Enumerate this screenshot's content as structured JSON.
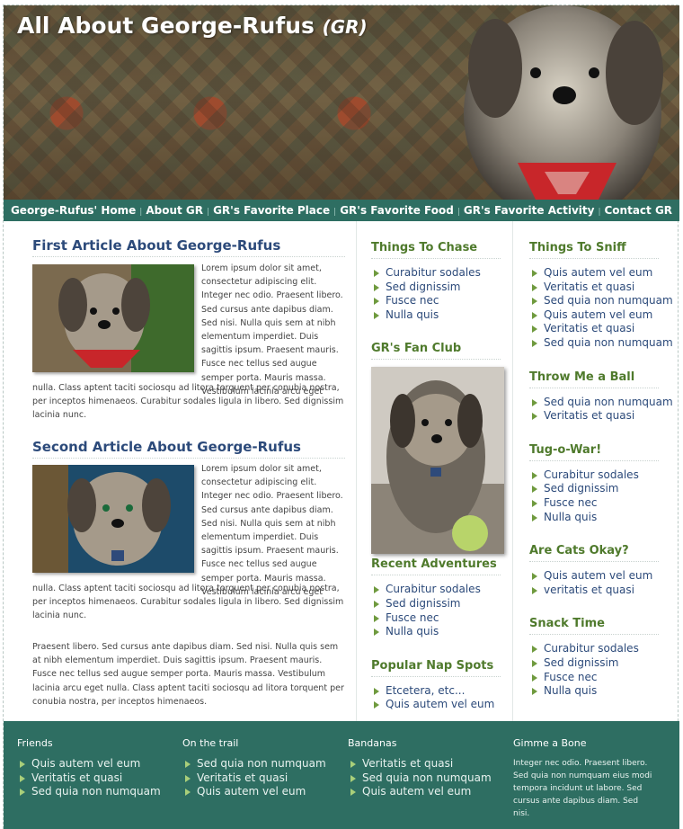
{
  "header": {
    "title": "All About George-Rufus",
    "title_abbr": "(GR)"
  },
  "nav": [
    "George-Rufus' Home",
    "About GR",
    "GR's Favorite Place",
    "GR's Favorite Food",
    "GR's Favorite Activity",
    "Contact GR"
  ],
  "articles": [
    {
      "title": "First Article About George-Rufus",
      "wrap_text": "Lorem ipsum dolor sit amet, consectetur adipiscing elit. Integer nec odio. Praesent libero. Sed cursus ante dapibus diam. Sed nisi. Nulla quis sem at nibh elementum imperdiet. Duis sagittis ipsum. Praesent mauris. Fusce nec tellus sed augue semper porta. Mauris massa. Vestibulum lacinia arcu eget",
      "full_text": "nulla. Class aptent taciti sociosqu ad litora torquent per conubia nostra, per inceptos himenaeos. Curabitur sodales ligula in libero. Sed dignissim lacinia nunc."
    },
    {
      "title": "Second Article About George-Rufus",
      "wrap_text": "Lorem ipsum dolor sit amet, consectetur adipiscing elit. Integer nec odio. Praesent libero. Sed cursus ante dapibus diam. Sed nisi. Nulla quis sem at nibh elementum imperdiet. Duis sagittis ipsum. Praesent mauris. Fusce nec tellus sed augue semper porta. Mauris massa. Vestibulum lacinia arcu eget",
      "full_text": "nulla. Class aptent taciti sociosqu ad litora torquent per conubia nostra, per inceptos himenaeos. Curabitur sodales ligula in libero. Sed dignissim lacinia nunc."
    }
  ],
  "closing_paragraph": "Praesent libero. Sed cursus ante dapibus diam. Sed nisi. Nulla quis sem at nibh elementum imperdiet. Duis sagittis ipsum. Praesent mauris. Fusce nec tellus sed augue semper porta. Mauris massa. Vestibulum lacinia arcu eget nulla. Class aptent taciti sociosqu ad litora torquent per conubia nostra, per inceptos himenaeos.",
  "column2": {
    "things_to_chase": {
      "title": "Things To Chase",
      "items": [
        "Curabitur sodales",
        "Sed dignissim",
        "Fusce nec",
        "Nulla quis"
      ]
    },
    "fan_club": {
      "title": "GR's Fan Club"
    },
    "recent_adventures": {
      "title": "Recent Adventures",
      "items": [
        "Curabitur sodales",
        "Sed dignissim",
        "Fusce nec",
        "Nulla quis"
      ]
    },
    "nap_spots": {
      "title": "Popular Nap Spots",
      "items": [
        "Etcetera, etc...",
        "Quis autem vel eum"
      ]
    }
  },
  "column3": {
    "things_to_sniff": {
      "title": "Things To Sniff",
      "items": [
        "Quis autem vel eum",
        "Veritatis et quasi",
        "Sed quia non numquam",
        "Quis autem vel eum",
        "Veritatis et quasi",
        "Sed quia non numquam"
      ]
    },
    "throw_ball": {
      "title": "Throw Me a Ball",
      "items": [
        "Sed quia non numquam",
        "Veritatis et quasi"
      ]
    },
    "tug_of_war": {
      "title": "Tug-o-War!",
      "items": [
        "Curabitur sodales",
        "Sed dignissim",
        "Fusce nec",
        "Nulla quis"
      ]
    },
    "cats": {
      "title": "Are Cats Okay?",
      "items": [
        "Quis autem vel eum",
        "veritatis et quasi"
      ]
    },
    "snack_time": {
      "title": "Snack Time",
      "items": [
        "Curabitur sodales",
        "Sed dignissim",
        "Fusce nec",
        "Nulla quis"
      ]
    }
  },
  "footer": {
    "friends": {
      "title": "Friends",
      "items": [
        "Quis autem vel eum",
        "Veritatis et quasi",
        "Sed quia non numquam"
      ]
    },
    "trail": {
      "title": "On the trail",
      "items": [
        "Sed quia non numquam",
        "Veritatis et quasi",
        "Quis autem vel eum"
      ]
    },
    "bandanas": {
      "title": "Bandanas",
      "items": [
        "Veritatis et quasi",
        "Sed quia non numquam",
        "Quis autem vel eum"
      ]
    },
    "bone": {
      "title": "Gimme a Bone",
      "text": "Integer nec odio. Praesent libero. Sed quia non numquam eius modi tempora incidunt ut labore. Sed cursus ante dapibus diam. Sed nisi."
    }
  },
  "colors": {
    "teal": "#2e6e62",
    "heading_blue": "#2c4a7a",
    "side_green": "#4f7a2c",
    "bullet_green": "#6f9a3e"
  }
}
